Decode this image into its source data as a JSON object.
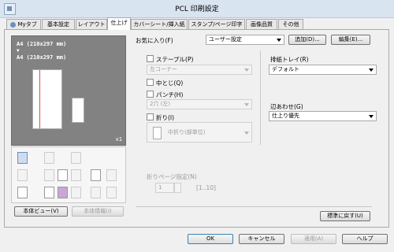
{
  "window": {
    "title": "PCL 印刷設定",
    "icon": "printer-app-icon"
  },
  "tabs": [
    {
      "label": "Myタブ",
      "icon": "star-person-icon",
      "active": false
    },
    {
      "label": "基本設定",
      "active": false
    },
    {
      "label": "レイアウト",
      "active": false
    },
    {
      "label": "仕上げ",
      "active": true
    },
    {
      "label": "カバーシート/挿入紙",
      "active": false
    },
    {
      "label": "スタンプ/ページ印字",
      "active": false
    },
    {
      "label": "画像品質",
      "active": false
    },
    {
      "label": "その他",
      "active": false
    }
  ],
  "preview": {
    "line1": "A4 (210x297 mm)",
    "arrow": "▼",
    "line2": "A4 (210x297 mm)",
    "scale": "x1"
  },
  "favorites": {
    "label": "お気に入り(F)",
    "value": "ユーザー設定",
    "add_label": "追加(D)...",
    "edit_label": "編集(E)..."
  },
  "finishing": {
    "staple": {
      "label": "ステープル(P)",
      "value": "左コーナー"
    },
    "center_binding": {
      "label": "中とじ(Q)"
    },
    "punch": {
      "label": "パンチ(H)",
      "value": "2穴 (左)"
    },
    "fold": {
      "label": "折り(I)",
      "value": "中折り(部単位)"
    }
  },
  "output_tray": {
    "label": "排紙トレイ(R)",
    "value": "デフォルト"
  },
  "alignment": {
    "label": "辺あわせ(G)",
    "value": "仕上り優先"
  },
  "fold_pages": {
    "label": "折りページ指定(N)",
    "value": "1",
    "range": "[1..10]"
  },
  "left_buttons": {
    "printer_view": "本体ビュー(V)",
    "printer_info": "本体情報(I)"
  },
  "restore_defaults": "標準に戻す(U)",
  "dialog_buttons": {
    "ok": "OK",
    "cancel": "キャンセル",
    "apply": "適用(A)",
    "help": "ヘルプ"
  },
  "colors": {
    "titlebar": "#d9e4f1",
    "preview_bg": "#828282",
    "accent": "#6f8fb8"
  }
}
